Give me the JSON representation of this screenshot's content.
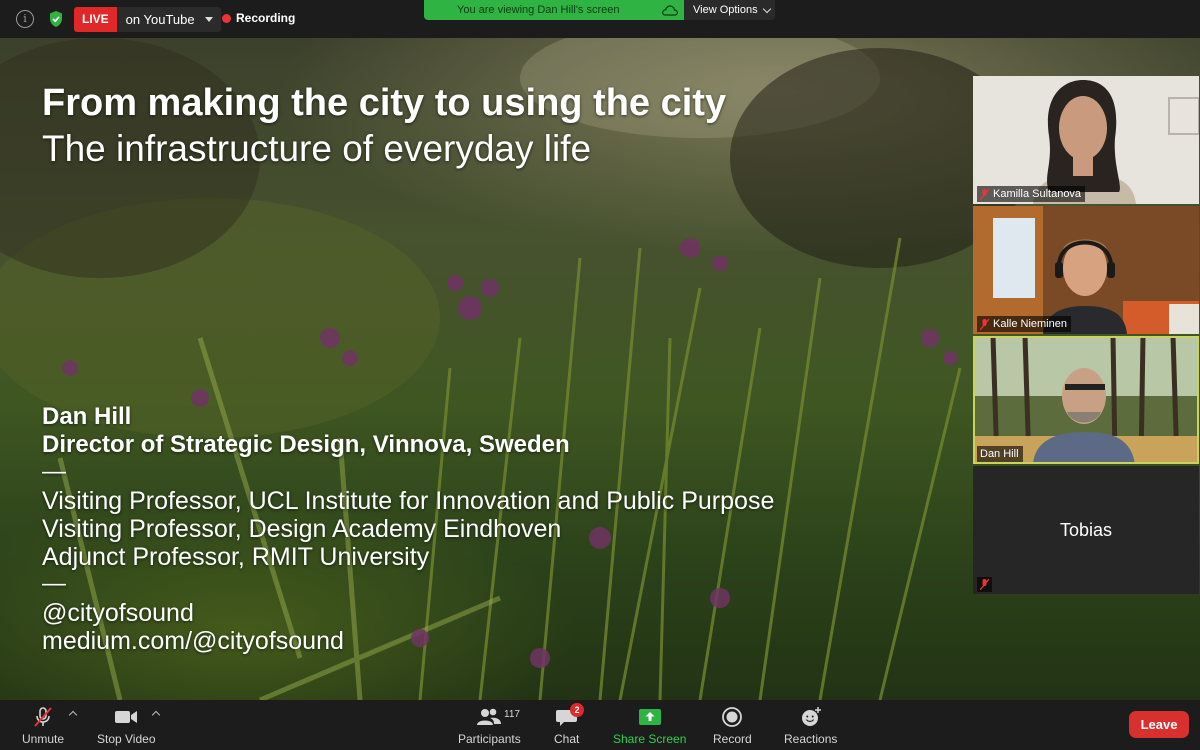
{
  "topbar": {
    "live_label": "LIVE",
    "live_destination": "on YouTube",
    "recording_label": "Recording",
    "viewing_notice": "You are viewing Dan Hill's screen",
    "view_options_label": "View Options"
  },
  "slide": {
    "title": "From making the city to using the city",
    "subtitle": "The infrastructure of everyday life",
    "speaker_name": "Dan Hill",
    "speaker_role": "Director of Strategic Design, Vinnova, Sweden",
    "separator": "—",
    "positions": [
      "Visiting Professor, UCL Institute for Innovation and Public Purpose",
      "Visiting Professor, Design Academy Eindhoven",
      "Adjunct Professor, RMIT University"
    ],
    "social": [
      "@cityofsound",
      "medium.com/@cityofsound"
    ]
  },
  "participants": [
    {
      "name": "Kamilla Sultanova",
      "muted": true,
      "video": true
    },
    {
      "name": "Kalle Nieminen",
      "muted": true,
      "video": true
    },
    {
      "name": "Dan Hill",
      "muted": false,
      "video": true,
      "active_speaker": true
    },
    {
      "name": "Tobias",
      "muted": true,
      "video": false
    }
  ],
  "toolbar": {
    "unmute_label": "Unmute",
    "stop_video_label": "Stop Video",
    "participants_label": "Participants",
    "participants_count": "117",
    "chat_label": "Chat",
    "chat_badge": "2",
    "share_label": "Share Screen",
    "record_label": "Record",
    "reactions_label": "Reactions",
    "leave_label": "Leave"
  },
  "colors": {
    "live_red": "#e02828",
    "share_green": "#2fb443",
    "speaker_outline": "#c8d55a",
    "leave_red": "#d82f2f"
  }
}
